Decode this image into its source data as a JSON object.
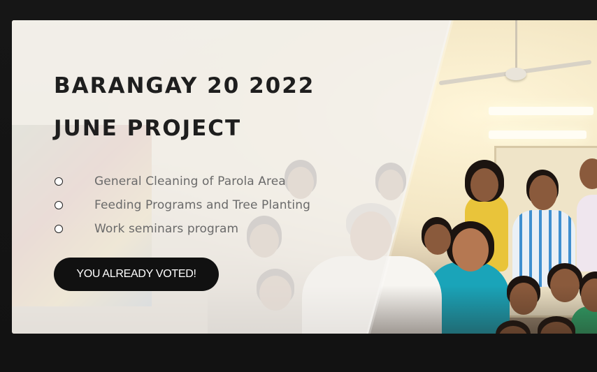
{
  "project": {
    "title_line1": "BARANGAY 20 2022",
    "title_line2": "JUNE PROJECT"
  },
  "options": [
    {
      "label": "General Cleaning of Parola Area",
      "selected": false
    },
    {
      "label": "Feeding Programs and Tree Planting",
      "selected": false
    },
    {
      "label": "Work seminars program",
      "selected": false
    }
  ],
  "vote_button": {
    "label": "YOU ALREADY VOTED!"
  },
  "colors": {
    "page_background": "#141414",
    "title": "#1e1e1e",
    "option_text": "#6a6a6a",
    "button_background": "#111111",
    "button_text": "#ffffff"
  }
}
